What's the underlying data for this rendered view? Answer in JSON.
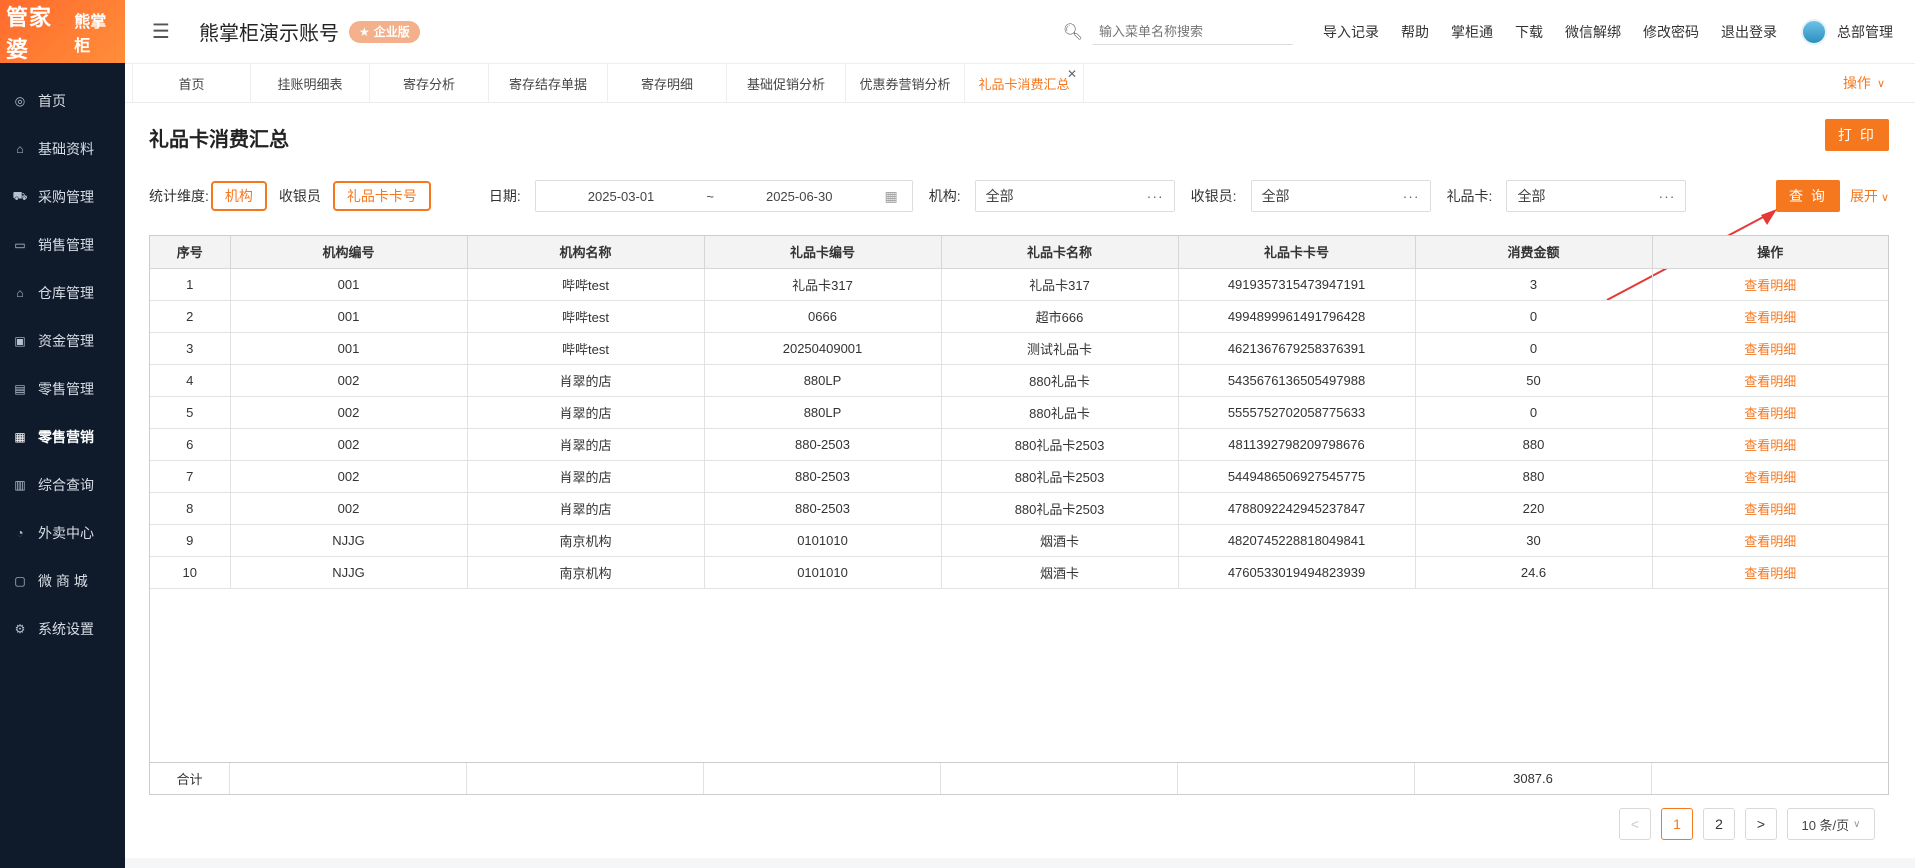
{
  "logo": {
    "main": "管家婆",
    "sub": "熊掌柜"
  },
  "sidebar": {
    "items": [
      {
        "label": "首页",
        "icon": "globe-icon"
      },
      {
        "label": "基础资料",
        "icon": "home-icon"
      },
      {
        "label": "采购管理",
        "icon": "cart-icon"
      },
      {
        "label": "销售管理",
        "icon": "card-icon"
      },
      {
        "label": "仓库管理",
        "icon": "warehouse-icon"
      },
      {
        "label": "资金管理",
        "icon": "finance-icon"
      },
      {
        "label": "零售管理",
        "icon": "chart-icon"
      },
      {
        "label": "零售营销",
        "icon": "gift-icon",
        "active": true
      },
      {
        "label": "综合查询",
        "icon": "bar-icon"
      },
      {
        "label": "外卖中心",
        "icon": "alarm-icon"
      },
      {
        "label": "微 商 城",
        "icon": "bag-icon"
      },
      {
        "label": "系统设置",
        "icon": "gear-icon"
      }
    ]
  },
  "header": {
    "account": "熊掌柜演示账号",
    "badge": "企业版",
    "search_placeholder": "输入菜单名称搜索",
    "links": [
      "导入记录",
      "帮助",
      "掌柜通",
      "下载",
      "微信解绑",
      "修改密码",
      "退出登录"
    ],
    "user": "总部管理"
  },
  "tabs": {
    "items": [
      "首页",
      "挂账明细表",
      "寄存分析",
      "寄存结存单据",
      "寄存明细",
      "基础促销分析",
      "优惠券营销分析",
      "礼品卡消费汇总"
    ],
    "active_index": 7,
    "operate": "操作"
  },
  "page": {
    "title": "礼品卡消费汇总",
    "print": "打 印"
  },
  "filters": {
    "dimension_label": "统计维度:",
    "dimensions": [
      "机构",
      "收银员",
      "礼品卡卡号"
    ],
    "date_label": "日期:",
    "date_start": "2025-03-01",
    "date_sep": "~",
    "date_end": "2025-06-30",
    "org_label": "机构:",
    "org_value": "全部",
    "cashier_label": "收银员:",
    "cashier_value": "全部",
    "card_label": "礼品卡:",
    "card_value": "全部",
    "query": "查 询",
    "expand": "展开"
  },
  "table": {
    "headers": [
      "序号",
      "机构编号",
      "机构名称",
      "礼品卡编号",
      "礼品卡名称",
      "礼品卡卡号",
      "消费金额",
      "操作"
    ],
    "rows": [
      [
        "1",
        "001",
        "哔哔test",
        "礼品卡317",
        "礼品卡317",
        "4919357315473947191",
        "3",
        "查看明细"
      ],
      [
        "2",
        "001",
        "哔哔test",
        "0666",
        "超市666",
        "4994899961491796428",
        "0",
        "查看明细"
      ],
      [
        "3",
        "001",
        "哔哔test",
        "20250409001",
        "测试礼品卡",
        "4621367679258376391",
        "0",
        "查看明细"
      ],
      [
        "4",
        "002",
        "肖翠的店",
        "880LP",
        "880礼品卡",
        "5435676136505497988",
        "50",
        "查看明细"
      ],
      [
        "5",
        "002",
        "肖翠的店",
        "880LP",
        "880礼品卡",
        "5555752702058775633",
        "0",
        "查看明细"
      ],
      [
        "6",
        "002",
        "肖翠的店",
        "880-2503",
        "880礼品卡2503",
        "4811392798209798676",
        "880",
        "查看明细"
      ],
      [
        "7",
        "002",
        "肖翠的店",
        "880-2503",
        "880礼品卡2503",
        "5449486506927545775",
        "880",
        "查看明细"
      ],
      [
        "8",
        "002",
        "肖翠的店",
        "880-2503",
        "880礼品卡2503",
        "4788092242945237847",
        "220",
        "查看明细"
      ],
      [
        "9",
        "NJJG",
        "南京机构",
        "0101010",
        "烟酒卡",
        "4820745228818049841",
        "30",
        "查看明细"
      ],
      [
        "10",
        "NJJG",
        "南京机构",
        "0101010",
        "烟酒卡",
        "4760533019494823939",
        "24.6",
        "查看明细"
      ]
    ],
    "footer_label": "合计",
    "footer_total": "3087.6"
  },
  "pagination": {
    "prev": "<",
    "pages": [
      "1",
      "2"
    ],
    "current": "1",
    "next": ">",
    "size": "10 条/页"
  },
  "colors": {
    "accent": "#f5781f",
    "sidebar": "#0f1b2b"
  }
}
